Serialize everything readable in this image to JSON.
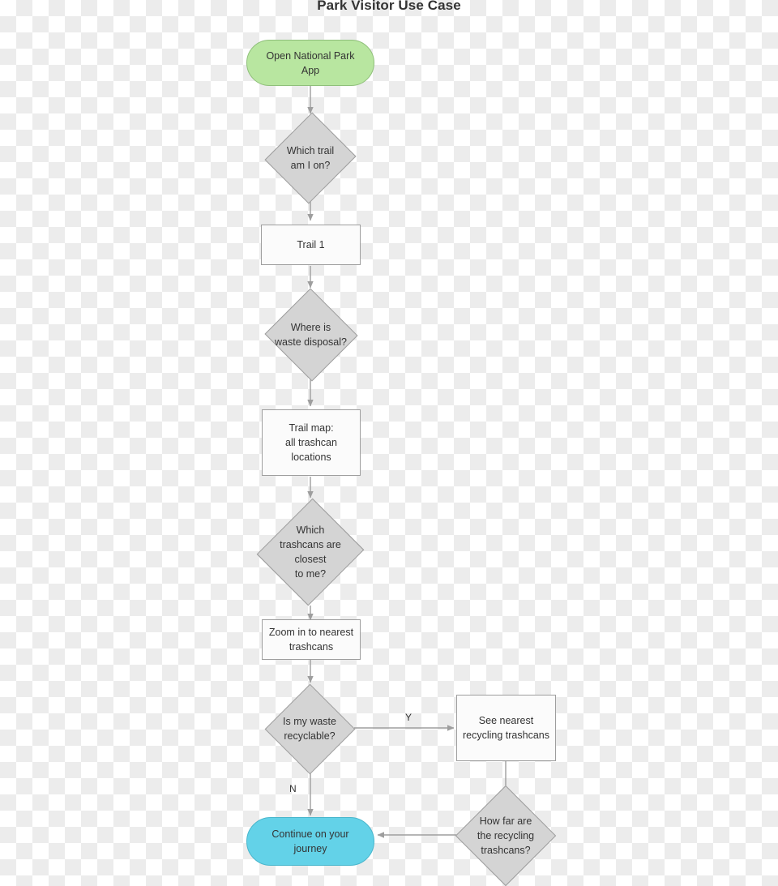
{
  "diagram": {
    "title": "Park Visitor Use Case",
    "type": "flowchart",
    "direction": "top-to-bottom",
    "colors": {
      "start_fill": "#b8e6a0",
      "start_stroke": "#8fbf7a",
      "end_fill": "#63d2e8",
      "end_stroke": "#49b6cc",
      "decision_fill": "#d4d4d4",
      "decision_stroke": "#9e9e9e",
      "process_fill": "#fbfbfb",
      "process_stroke": "#9e9e9e",
      "edge_stroke": "#9e9e9e",
      "text": "#333333",
      "title_text": "#333333"
    }
  },
  "nodes": [
    {
      "id": "start",
      "shape": "stadium",
      "role": "start",
      "label": "Open National Park\nApp"
    },
    {
      "id": "which_trail",
      "shape": "diamond",
      "role": "decision",
      "label": "Which trail\nam I on?"
    },
    {
      "id": "trail1",
      "shape": "rectangle",
      "role": "process",
      "label": "Trail 1"
    },
    {
      "id": "where_waste",
      "shape": "diamond",
      "role": "decision",
      "label": "Where is\nwaste disposal?"
    },
    {
      "id": "trail_map",
      "shape": "rectangle",
      "role": "process",
      "label": "Trail map:\nall trashcan\nlocations"
    },
    {
      "id": "which_trashcans",
      "shape": "diamond",
      "role": "decision",
      "label": "Which\ntrashcans are\nclosest\nto me?"
    },
    {
      "id": "zoom_in",
      "shape": "rectangle",
      "role": "process",
      "label": "Zoom in to nearest\ntrashcans"
    },
    {
      "id": "recyclable",
      "shape": "diamond",
      "role": "decision",
      "label": "Is my waste\nrecyclable?"
    },
    {
      "id": "see_nearest",
      "shape": "rectangle",
      "role": "process",
      "label": "See nearest\nrecycling trashcans"
    },
    {
      "id": "how_far",
      "shape": "diamond",
      "role": "decision",
      "label": "How far are\nthe recycling\ntrashcans?"
    },
    {
      "id": "continue",
      "shape": "stadium",
      "role": "end",
      "label": "Continue on your\njourney"
    }
  ],
  "edges": [
    {
      "from": "start",
      "to": "which_trail",
      "label": ""
    },
    {
      "from": "which_trail",
      "to": "trail1",
      "label": ""
    },
    {
      "from": "trail1",
      "to": "where_waste",
      "label": ""
    },
    {
      "from": "where_waste",
      "to": "trail_map",
      "label": ""
    },
    {
      "from": "trail_map",
      "to": "which_trashcans",
      "label": ""
    },
    {
      "from": "which_trashcans",
      "to": "zoom_in",
      "label": ""
    },
    {
      "from": "zoom_in",
      "to": "recyclable",
      "label": ""
    },
    {
      "from": "recyclable",
      "to": "see_nearest",
      "label": "Y"
    },
    {
      "from": "recyclable",
      "to": "continue",
      "label": "N"
    },
    {
      "from": "see_nearest",
      "to": "how_far",
      "label": ""
    },
    {
      "from": "how_far",
      "to": "continue",
      "label": ""
    }
  ],
  "edge_labels": {
    "yes": "Y",
    "no": "N"
  }
}
